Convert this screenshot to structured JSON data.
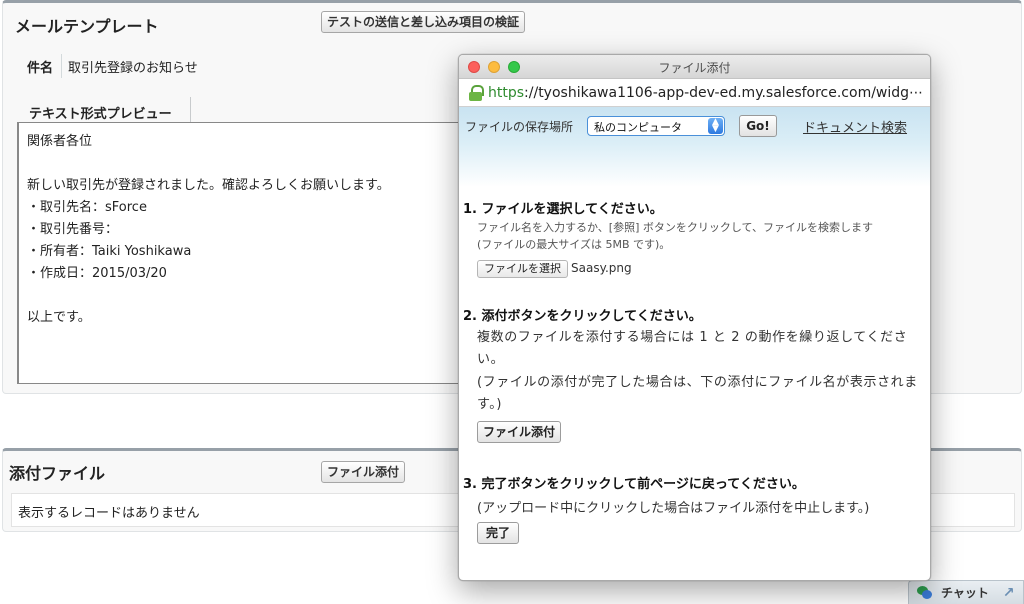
{
  "template_section": {
    "title": "メールテンプレート",
    "verify_button": "テストの送信と差し込み項目の検証",
    "subject_label": "件名",
    "subject_value": "取引先登録のお知らせ",
    "preview_tab": "テキスト形式プレビュー",
    "preview_lines": [
      "関係者各位",
      "",
      "新しい取引先が登録されました。確認よろしくお願いします。",
      "・取引先名：sForce",
      "・取引先番号：",
      "・所有者：Taiki Yoshikawa",
      "・作成日：2015/03/20",
      "",
      "以上です。"
    ]
  },
  "attachments_section": {
    "title": "添付ファイル",
    "attach_button": "ファイル添付",
    "empty_message": "表示するレコードはありません"
  },
  "chat": {
    "label": "チャット"
  },
  "popup": {
    "window_title": "ファイル添付",
    "url_scheme": "https",
    "url_rest": "://tyoshikawa1106-app-dev-ed.my.salesforce.com/widg⋯",
    "location_label": "ファイルの保存場所",
    "location_selected": "私のコンピュータ",
    "go_button": "Go!",
    "document_search": "ドキュメント検索",
    "step1": {
      "title": "1. ファイルを選択してください。",
      "line1": "ファイル名を入力するか、[参照] ボタンをクリックして、ファイルを検索します",
      "line2": "(ファイルの最大サイズは 5MB です)。",
      "choose_button": "ファイルを選択",
      "chosen_file": "Saasy.png"
    },
    "step2": {
      "title": "2. 添付ボタンをクリックしてください。",
      "line1": "複数のファイルを添付する場合には 1 と 2 の動作を繰り返してくださ",
      "line2": "い。",
      "line3": "(ファイルの添付が完了した場合は、下の添付にファイル名が表示されま",
      "line4": "す。)",
      "button": "ファイル添付"
    },
    "step3": {
      "title": "3. 完了ボタンをクリックして前ページに戻ってください。",
      "line1": "(アップロード中にクリックした場合はファイル添付を中止します。)",
      "button": "完了"
    }
  }
}
